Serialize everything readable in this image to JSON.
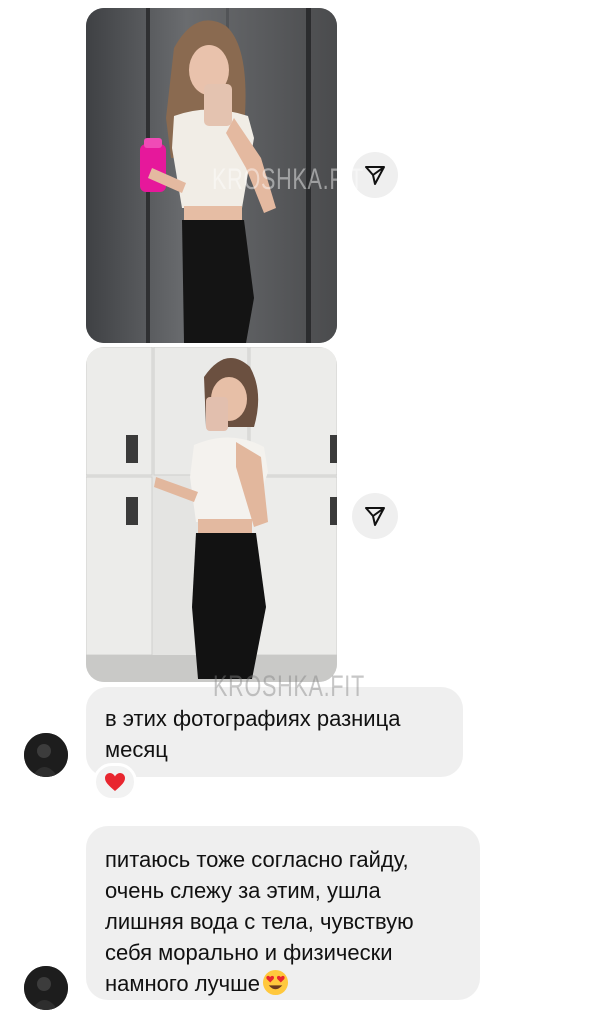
{
  "messages": [
    {
      "type": "image",
      "watermark": "KROSHKA.FIT",
      "share_icon": "send-arrow-icon"
    },
    {
      "type": "image",
      "share_icon": "send-arrow-icon"
    },
    {
      "type": "text",
      "lines": [
        "в этих фотографиях разница",
        "месяц"
      ],
      "reaction": "heart-emoji",
      "watermark": "KROSHKA.FIT"
    },
    {
      "type": "text",
      "lines": [
        "питаюсь тоже согласно гайду,",
        "очень слежу за этим, ушла",
        "лишняя вода с тела, чувствую",
        "себя морально и физически",
        "намного лучше"
      ],
      "trailing_emoji": "heart-eyes-emoji"
    }
  ],
  "colors": {
    "bubble": "#efefef",
    "text": "#111111",
    "heart": "#e8262f"
  }
}
